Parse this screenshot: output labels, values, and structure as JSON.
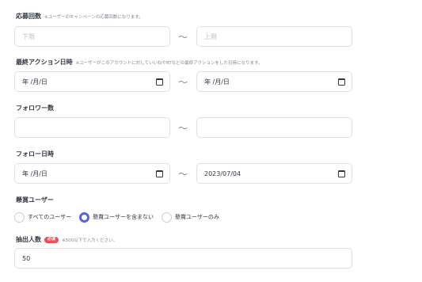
{
  "entries": {
    "label": "応募回数",
    "note": "※ユーザーのキャンペーンの応募回数になります。",
    "min_placeholder": "下限",
    "max_placeholder": "上限",
    "separator": "〜"
  },
  "last_action": {
    "label": "最終アクション日時",
    "note": "※ユーザーがこのアカウントに対していいねやRTなどの最終アクションをした日時になります。",
    "start_value": "年 /月/日",
    "end_value": "年 /月/日",
    "separator": "〜"
  },
  "followers": {
    "label": "フォロワー数",
    "min_value": "",
    "max_value": "",
    "separator": "〜"
  },
  "follow_date": {
    "label": "フォロー日時",
    "start_value": "年 /月/日",
    "end_value": "2023/07/04",
    "separator": "〜"
  },
  "prize_users": {
    "label": "懸賞ユーザー",
    "options": [
      {
        "label": "すべてのユーザー",
        "selected": false
      },
      {
        "label": "懸賞ユーザーを含まない",
        "selected": true
      },
      {
        "label": "懸賞ユーザーのみ",
        "selected": false
      }
    ]
  },
  "winners": {
    "label": "抽出人数",
    "required_badge": "必須",
    "note": "※500以下で入力ください。",
    "value": "50"
  },
  "colors": {
    "accent": "#5b63d6",
    "required_badge": "#e8505b",
    "border": "#dde1e7"
  },
  "icons": {
    "date_picker": "calendar-icon"
  }
}
